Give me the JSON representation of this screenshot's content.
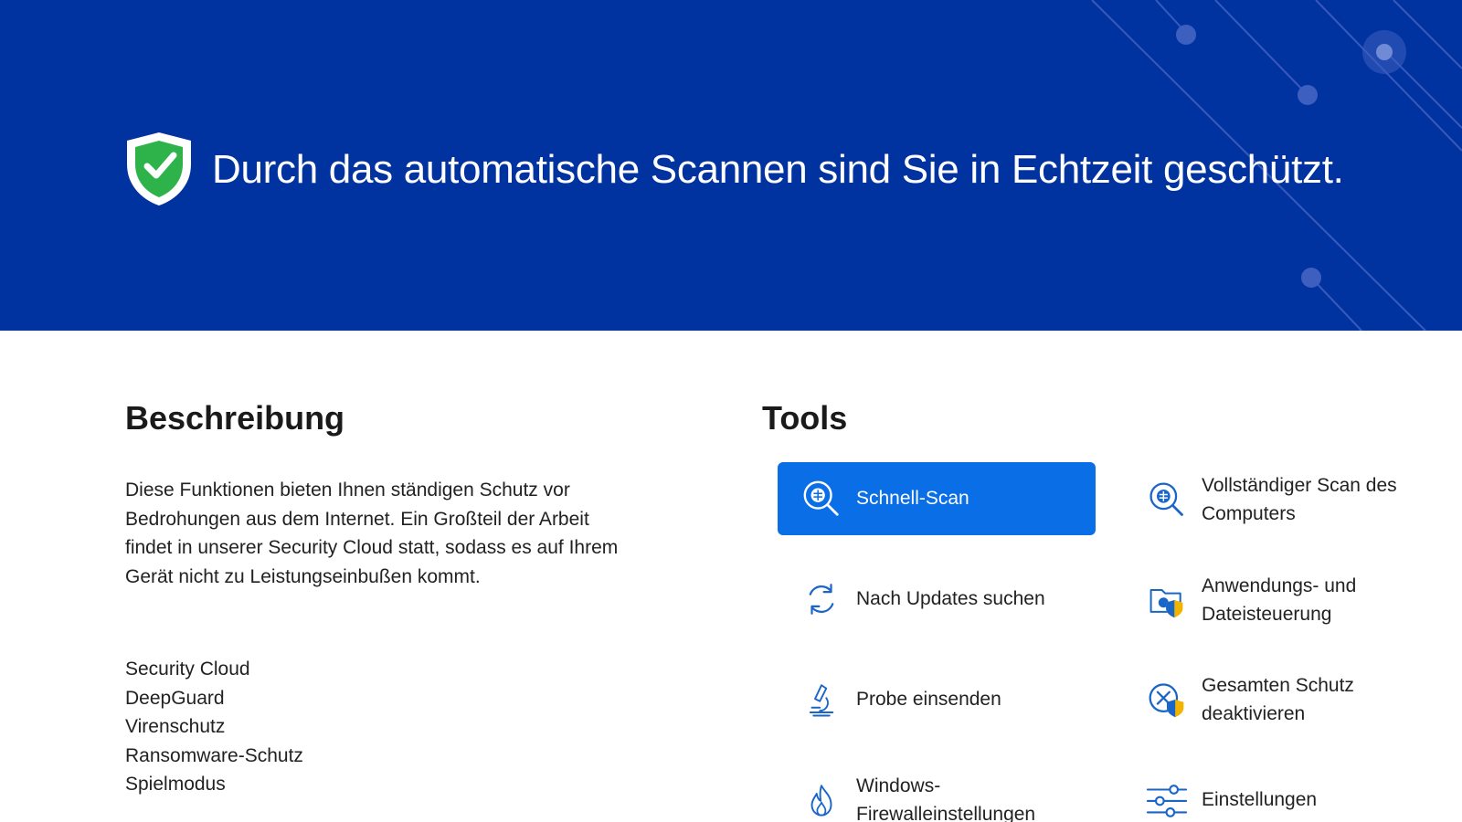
{
  "banner": {
    "title": "Durch das automatische Scannen sind Sie in Echtzeit geschützt.",
    "icon": "shield-check-icon",
    "background_color": "#0033a0"
  },
  "description": {
    "heading": "Beschreibung",
    "text": "Diese Funktionen bieten Ihnen ständigen Schutz vor Bedrohungen aus dem Internet. Ein Großteil der Arbeit findet in unserer Security Cloud statt, sodass es auf Ihrem Gerät nicht zu Leistungseinbußen kommt.",
    "features": [
      "Security Cloud",
      "DeepGuard",
      "Virenschutz",
      "Ransomware-Schutz",
      "Spielmodus"
    ]
  },
  "tools": {
    "heading": "Tools",
    "accent_color": "#0a6ee6",
    "items": [
      {
        "label": "Schnell-Scan",
        "icon": "quick-scan-icon"
      },
      {
        "label": "Vollständiger Scan des Computers",
        "icon": "full-scan-icon"
      },
      {
        "label": "Nach Updates suchen",
        "icon": "refresh-icon"
      },
      {
        "label": "Anwendungs- und Dateisteuerung",
        "icon": "folder-shield-icon"
      },
      {
        "label": "Probe einsenden",
        "icon": "microscope-icon"
      },
      {
        "label": "Gesamten Schutz deaktivieren",
        "icon": "disable-protection-icon"
      },
      {
        "label": "Windows-Firewalleinstellungen",
        "icon": "firewall-icon"
      },
      {
        "label": "Einstellungen",
        "icon": "sliders-icon"
      }
    ]
  }
}
